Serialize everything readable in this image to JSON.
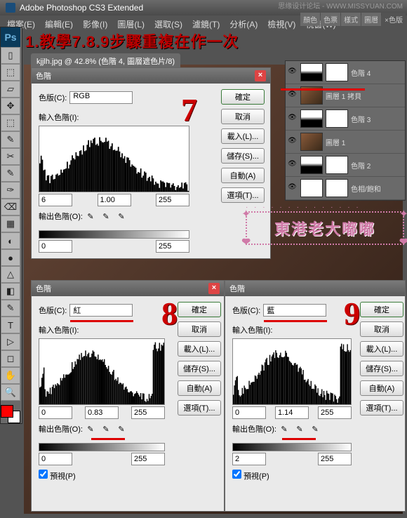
{
  "app": {
    "title": "Adobe Photoshop CS3 Extended"
  },
  "watermark": "思缘设计论坛 - WWW.MISSYUAN.COM",
  "menu": [
    "檔案(E)",
    "編輯(E)",
    "影像(I)",
    "圖層(L)",
    "選取(S)",
    "濾鏡(T)",
    "分析(A)",
    "檢視(V)",
    "視窗(W)"
  ],
  "right_tabs": [
    "顏色",
    "色票",
    "樣式",
    "圖層",
    "×色版"
  ],
  "doc_tab": "kjjlh.jpg @ 42.8% (色階 4, 圖層遮色片/8)",
  "annotation": {
    "main": "1.教學7.8.9步驟重複在作一次",
    "n7": "7",
    "n8": "8",
    "n9": "9"
  },
  "levels7": {
    "title": "色階",
    "channel_lbl": "色版(C):",
    "channel": "RGB",
    "input_lbl": "輸入色階(I):",
    "in_low": "6",
    "in_mid": "1.00",
    "in_high": "255",
    "output_lbl": "輸出色階(O):",
    "out_low": "0",
    "out_high": "255",
    "btn_ok": "確定",
    "btn_cancel": "取消",
    "btn_load": "載入(L)...",
    "btn_save": "儲存(S)...",
    "btn_auto": "自動(A)",
    "btn_opt": "選項(T)..."
  },
  "levels8": {
    "title": "色階",
    "channel_lbl": "色版(C):",
    "channel": "紅",
    "input_lbl": "輸入色階(I):",
    "in_low": "0",
    "in_mid": "0.83",
    "in_high": "255",
    "output_lbl": "輸出色階(O):",
    "out_low": "0",
    "out_high": "255",
    "btn_ok": "確定",
    "btn_cancel": "取消",
    "btn_load": "載入(L)...",
    "btn_save": "儲存(S)...",
    "btn_auto": "自動(A)",
    "btn_opt": "選項(T)...",
    "preview": "預視(P)"
  },
  "levels9": {
    "title": "色階",
    "channel_lbl": "色版(C):",
    "channel": "藍",
    "input_lbl": "輸入色階(I):",
    "in_low": "0",
    "in_mid": "1.14",
    "in_high": "255",
    "output_lbl": "輸出色階(O):",
    "out_low": "2",
    "out_high": "255",
    "btn_ok": "確定",
    "btn_cancel": "取消",
    "btn_load": "載入(L)...",
    "btn_save": "儲存(S)...",
    "btn_auto": "自動(A)",
    "btn_opt": "選項(T)...",
    "preview": "預視(P)"
  },
  "layers": [
    {
      "name": "色階 4",
      "t1": "histo-t",
      "t2": "white"
    },
    {
      "name": "圖層 1 拷貝",
      "t1": "img",
      "t2": ""
    },
    {
      "name": "色階 3",
      "t1": "histo-t",
      "t2": "white"
    },
    {
      "name": "圖層 1",
      "t1": "img",
      "t2": ""
    },
    {
      "name": "色階 2",
      "t1": "histo-t",
      "t2": "white"
    },
    {
      "name": "色相/飽和",
      "t1": "white",
      "t2": "white"
    }
  ],
  "pink": "東港老大嘟嘟",
  "tools": [
    "▯",
    "⬚",
    "▱",
    "✥",
    "⬚",
    "✎",
    "✂",
    "✎",
    "✑",
    "⌫",
    "▦",
    "◐",
    "●",
    "△",
    "◧",
    "✎",
    "T",
    "▷",
    "◻",
    "✋",
    "🔍"
  ]
}
